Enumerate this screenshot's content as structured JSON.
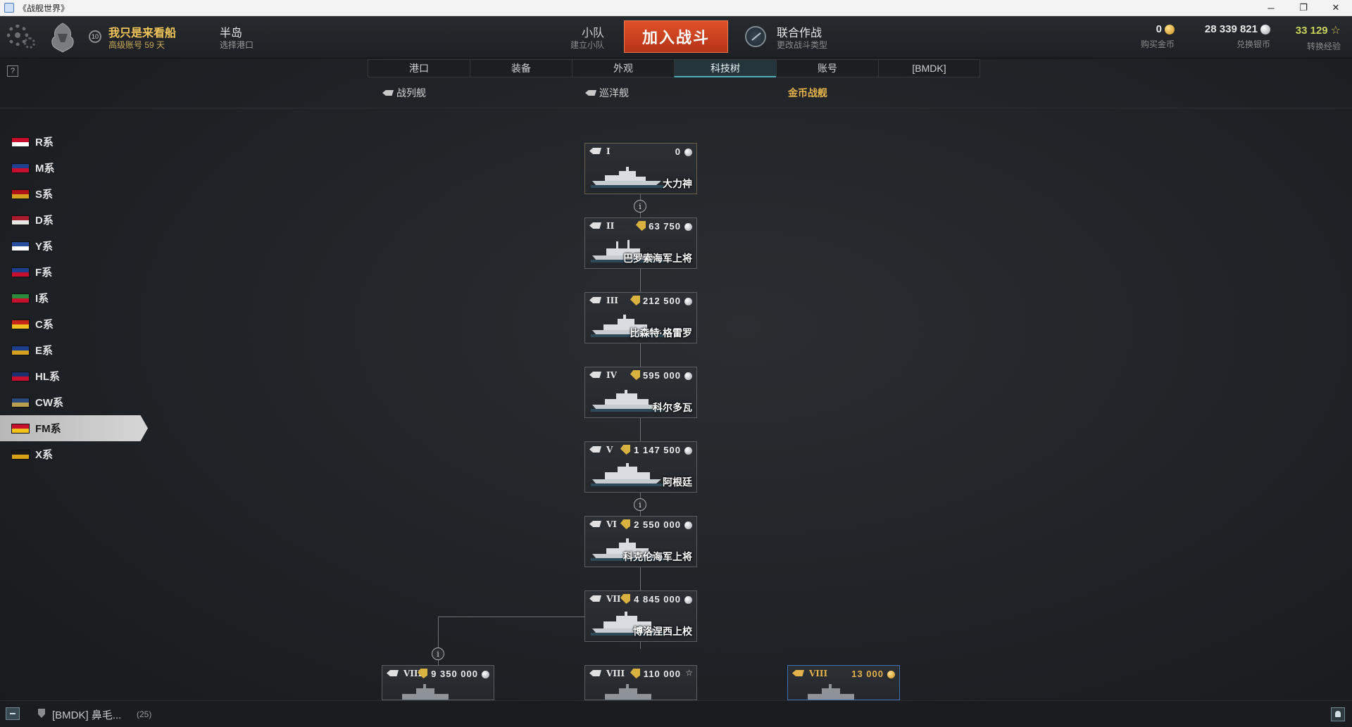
{
  "window": {
    "title": "《战舰世界》",
    "controls": [
      "─",
      "❐",
      "✕"
    ]
  },
  "topbar": {
    "player_name": "我只是来看船",
    "account_type": "高级账号  59 天",
    "level": "10",
    "port_name": "半岛",
    "port_sub": "选择港口",
    "division_label": "小队",
    "division_sub": "建立小队",
    "battle_button": "加入战斗",
    "mode_label": "联合作战",
    "mode_sub": "更改战斗类型",
    "gold_value": "0",
    "gold_sub": "购买金币",
    "silver_value": "28  339  821",
    "silver_sub": "兑换银币",
    "xp_value": "33  129",
    "xp_sub": "转换经验"
  },
  "help": "?",
  "main_tabs": [
    {
      "label": "港口"
    },
    {
      "label": "装备"
    },
    {
      "label": "外观"
    },
    {
      "label": "科技树"
    },
    {
      "label": "账号"
    },
    {
      "label": "[BMDK]"
    }
  ],
  "sub_tabs": [
    {
      "label": "战列舰"
    },
    {
      "label": "巡洋舰"
    },
    {
      "label": "金币战舰"
    }
  ],
  "nations": [
    {
      "label": "R系",
      "flag_colors": [
        "#c8102e",
        "#ffffff"
      ]
    },
    {
      "label": "M系",
      "flag_colors": [
        "#1f3f8f",
        "#c8102e"
      ]
    },
    {
      "label": "S系",
      "flag_colors": [
        "#b01218",
        "#d4a020"
      ]
    },
    {
      "label": "D系",
      "flag_colors": [
        "#a81c2b",
        "#e8e8e8"
      ]
    },
    {
      "label": "Y系",
      "flag_colors": [
        "#2a4fa0",
        "#ffffff"
      ]
    },
    {
      "label": "F系",
      "flag_colors": [
        "#1c3f90",
        "#c8102e"
      ]
    },
    {
      "label": "I系",
      "flag_colors": [
        "#2c8a3c",
        "#c8102e"
      ]
    },
    {
      "label": "C系",
      "flag_colors": [
        "#c8281c",
        "#f0c020"
      ]
    },
    {
      "label": "E系",
      "flag_colors": [
        "#1c3c8c",
        "#d4a020"
      ]
    },
    {
      "label": "HL系",
      "flag_colors": [
        "#1c2f6e",
        "#c8102e"
      ]
    },
    {
      "label": "CW系",
      "flag_colors": [
        "#2a4a7e",
        "#b8a050"
      ]
    },
    {
      "label": "FM系",
      "flag_colors": [
        "#c8102e",
        "#f2c21a"
      ]
    },
    {
      "label": "X系",
      "flag_colors": [
        "#1a1a1a",
        "#d8a018"
      ]
    }
  ],
  "active_nation": "FM系",
  "ships": [
    {
      "tier": "I",
      "price": "0",
      "currency": "silver",
      "name": "大力神",
      "discount": false
    },
    {
      "tier": "II",
      "price": "63  750",
      "currency": "silver",
      "name": "巴罗索海军上将",
      "discount": true
    },
    {
      "tier": "III",
      "price": "212  500",
      "currency": "silver",
      "name": "比森特·格雷罗",
      "discount": true
    },
    {
      "tier": "IV",
      "price": "595  000",
      "currency": "silver",
      "name": "科尔多瓦",
      "discount": true
    },
    {
      "tier": "V",
      "price": "1  147  500",
      "currency": "silver",
      "name": "阿根廷",
      "discount": true
    },
    {
      "tier": "VI",
      "price": "2  550  000",
      "currency": "silver",
      "name": "科克伦海军上将",
      "discount": true
    },
    {
      "tier": "VII",
      "price": "4  845  000",
      "currency": "silver",
      "name": "博洛涅西上校",
      "discount": true
    },
    {
      "tier": "VIII",
      "price": "9  350  000",
      "currency": "silver",
      "name": "",
      "discount": true
    },
    {
      "tier": "VIII",
      "price": "110  000",
      "currency": "xp",
      "name": "",
      "discount": true
    },
    {
      "tier": "VIII",
      "price": "13  000",
      "currency": "gold",
      "name": "",
      "discount": false
    }
  ],
  "info_marker": "i",
  "bottombar": {
    "clan_text": "[BMDK]  鼻毛...",
    "clan_count": "(25)"
  }
}
